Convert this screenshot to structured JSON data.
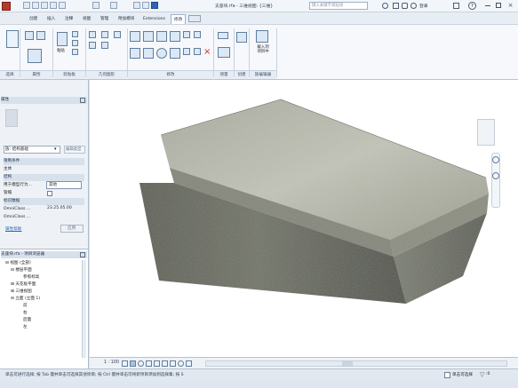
{
  "title_bar": {
    "title": "支座块.rfa - 三维视图: {三维}",
    "search_placeholder": "键入关键字或短语",
    "login": "登录"
  },
  "ribbon_tabs": [
    "创建",
    "插入",
    "注释",
    "视图",
    "管理",
    "附加模块",
    "Extensions",
    "修改"
  ],
  "ribbon_panels": [
    "选择",
    "属性",
    "剪贴板",
    "几何图形",
    "修改",
    "测量",
    "创建",
    "族编辑器"
  ],
  "ribbon_buttons": {
    "paste": "粘贴",
    "load_into_project": "载入到\n项目中"
  },
  "properties": {
    "panel_title": "属性",
    "type_selector": "族: 结构基础",
    "edit_type": "编辑类型",
    "sections": [
      "限制条件",
      "结构",
      "标识数据"
    ],
    "rows": [
      {
        "label": "主体",
        "value": ""
      },
      {
        "label": "用于模型行为...",
        "value": "其他"
      },
      {
        "label": "管帽",
        "value": ""
      },
      {
        "label": "OmniClass ...",
        "value": "23.25.05.00"
      },
      {
        "label": "OmniClass ...",
        "value": ""
      }
    ],
    "help_link": "属性帮助",
    "apply_button": "应用"
  },
  "browser": {
    "title": "支座块.rfa - 项目浏览器",
    "items": [
      {
        "label": "视图 (全部)",
        "level": 0
      },
      {
        "label": "楼层平面",
        "level": 1
      },
      {
        "label": "参照标高",
        "level": 2
      },
      {
        "label": "天花板平面",
        "level": 1
      },
      {
        "label": "三维视图",
        "level": 1
      },
      {
        "label": "立面 (立面 1)",
        "level": 1
      },
      {
        "label": "前",
        "level": 2
      },
      {
        "label": "右",
        "level": 2
      },
      {
        "label": "后面",
        "level": 2
      },
      {
        "label": "左",
        "level": 2
      }
    ]
  },
  "view_controls": {
    "scale": "1 : 100"
  },
  "status_bar": {
    "message": "单击可进行选择; 按 Tab 键并单击可选择其他项目; 按 Ctrl 键并单击可将新项目添加到选择集; 按 S",
    "toggle_label": "单击可选择",
    "filter_count": ":0"
  },
  "colors": {
    "accent": "#2f66b3",
    "active_tab": "#ffffff",
    "panel_bg": "#eef2f7"
  }
}
